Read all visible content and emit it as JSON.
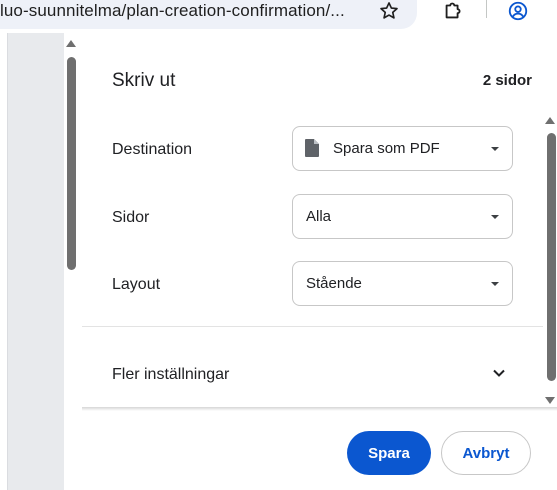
{
  "browser": {
    "url_text": "luo-suunnitelma/plan-creation-confirmation/...",
    "icons": {
      "bookmark": "star-icon",
      "extensions": "puzzle-icon",
      "profile": "account-circle-icon"
    }
  },
  "print_dialog": {
    "title": "Skriv ut",
    "page_count": "2 sidor",
    "rows": [
      {
        "label": "Destination",
        "value": "Spara som PDF",
        "icon": "document-icon"
      },
      {
        "label": "Sidor",
        "value": "Alla"
      },
      {
        "label": "Layout",
        "value": "Stående"
      }
    ],
    "more_settings_label": "Fler inställningar",
    "buttons": {
      "save": "Spara",
      "cancel": "Avbryt"
    }
  },
  "colors": {
    "primary": "#0b57d0",
    "text": "#202124",
    "border": "#c7c7c7",
    "preview_bg": "#e8eaed",
    "url_bg": "#eef1f8"
  }
}
